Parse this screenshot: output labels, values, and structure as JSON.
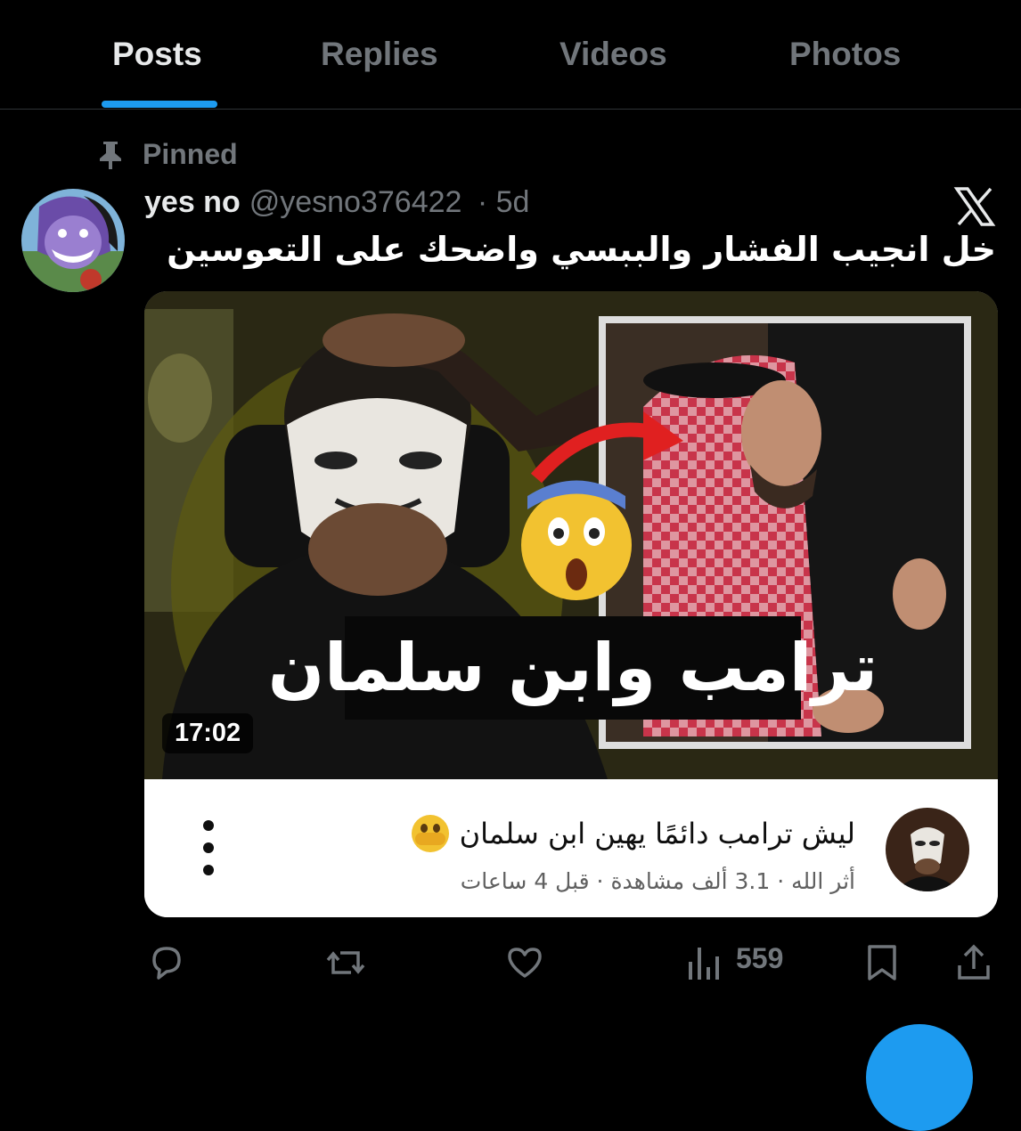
{
  "tabs": [
    {
      "label": "Posts",
      "active": true
    },
    {
      "label": "Replies"
    },
    {
      "label": "Videos"
    },
    {
      "label": "Photos"
    }
  ],
  "pinned_label": "Pinned",
  "post": {
    "author_name": "yes no",
    "author_handle": "@yesno376422",
    "time": "· 5d",
    "text": "خل انجيب الفشار والببسي واضحك على التعوسين",
    "views": "559"
  },
  "video_card": {
    "thumbnail_caption": "ترامب وابن سلمان",
    "duration": "17:02",
    "title": "ليش ترامب دائمًا يهين ابن سلمان",
    "meta": "أثر الله · 3.1 ألف مشاهدة · قبل 4 ساعات"
  },
  "colors": {
    "accent": "#1d9bf0",
    "background": "#000000",
    "muted": "#71767b"
  },
  "icons": [
    "pin-icon",
    "x-logo-icon",
    "reply-icon",
    "repost-icon",
    "like-icon",
    "views-icon",
    "bookmark-icon",
    "share-icon",
    "kebab-icon"
  ]
}
